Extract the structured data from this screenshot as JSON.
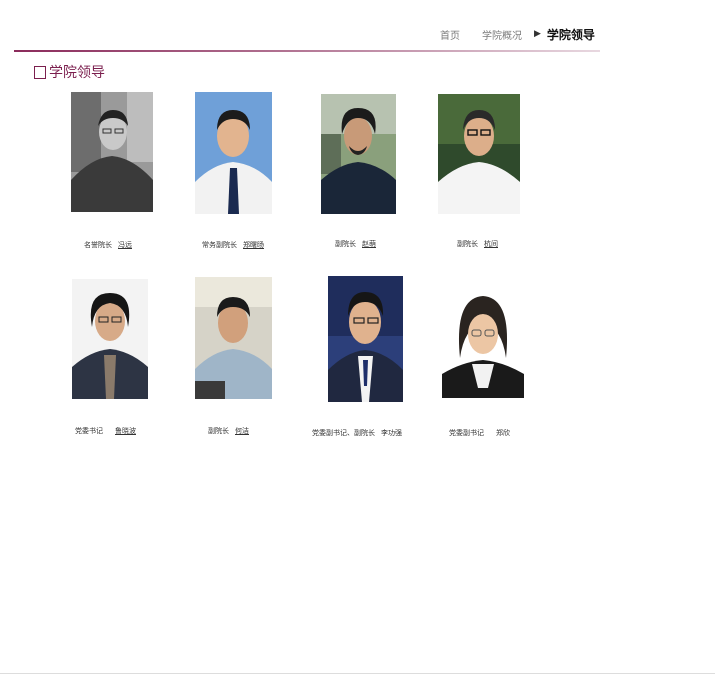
{
  "breadcrumb": {
    "home": "首页",
    "about": "学院概况",
    "current": "学院领导"
  },
  "section_title": "学院领导",
  "leaders": [
    {
      "title": "名誉院长",
      "name": "冯远"
    },
    {
      "title": "常务副院长",
      "name": "郑曙旸"
    },
    {
      "title": "副院长",
      "name": "赵萌"
    },
    {
      "title": "副院长",
      "name": "杭间"
    },
    {
      "title": "党委书记",
      "name": "鲁晓波"
    },
    {
      "title": "副院长",
      "name": "何洁"
    },
    {
      "title": "党委副书记、副院长",
      "name": "李功强"
    },
    {
      "title": "党委副书记",
      "name": "郑欣"
    }
  ],
  "colors": {
    "accent": "#7b1f4e"
  }
}
